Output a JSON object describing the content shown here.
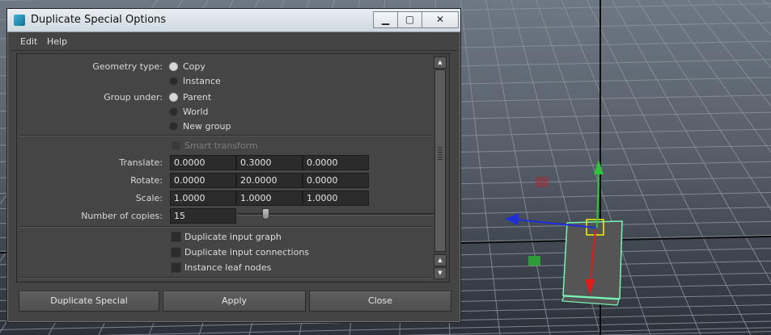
{
  "window": {
    "title": "Duplicate Special Options",
    "controls": {
      "minimize": "▁",
      "maximize": "▢",
      "close": "✕"
    }
  },
  "menu": {
    "edit": "Edit",
    "help": "Help"
  },
  "geometry_type": {
    "label": "Geometry type:",
    "options": [
      "Copy",
      "Instance"
    ],
    "selected": "Copy"
  },
  "group_under": {
    "label": "Group under:",
    "options": [
      "Parent",
      "World",
      "New group"
    ],
    "selected": "Parent"
  },
  "smart_transform": {
    "label": "Smart transform",
    "enabled": false,
    "checked": false
  },
  "translate": {
    "label": "Translate:",
    "values": [
      "0.0000",
      "0.3000",
      "0.0000"
    ]
  },
  "rotate": {
    "label": "Rotate:",
    "values": [
      "0.0000",
      "20.0000",
      "0.0000"
    ]
  },
  "scale": {
    "label": "Scale:",
    "values": [
      "1.0000",
      "1.0000",
      "1.0000"
    ]
  },
  "copies": {
    "label": "Number of copies:",
    "value": "15",
    "slider_fraction": 0.14
  },
  "checkboxes": [
    "Duplicate input graph",
    "Duplicate input connections",
    "Instance leaf nodes"
  ],
  "buttons": {
    "duplicate": "Duplicate Special",
    "apply": "Apply",
    "close": "Close"
  },
  "colors": {
    "viewport_top": "#6a7480",
    "viewport_bottom": "#2b3038",
    "grid": "#8a919a",
    "axis": "#111111",
    "x_arrow": "#2030d8",
    "y_arrow": "#30c030",
    "z_arrow": "#e02020",
    "selection": "#6bf0b0",
    "pivot": "#ffff00"
  }
}
